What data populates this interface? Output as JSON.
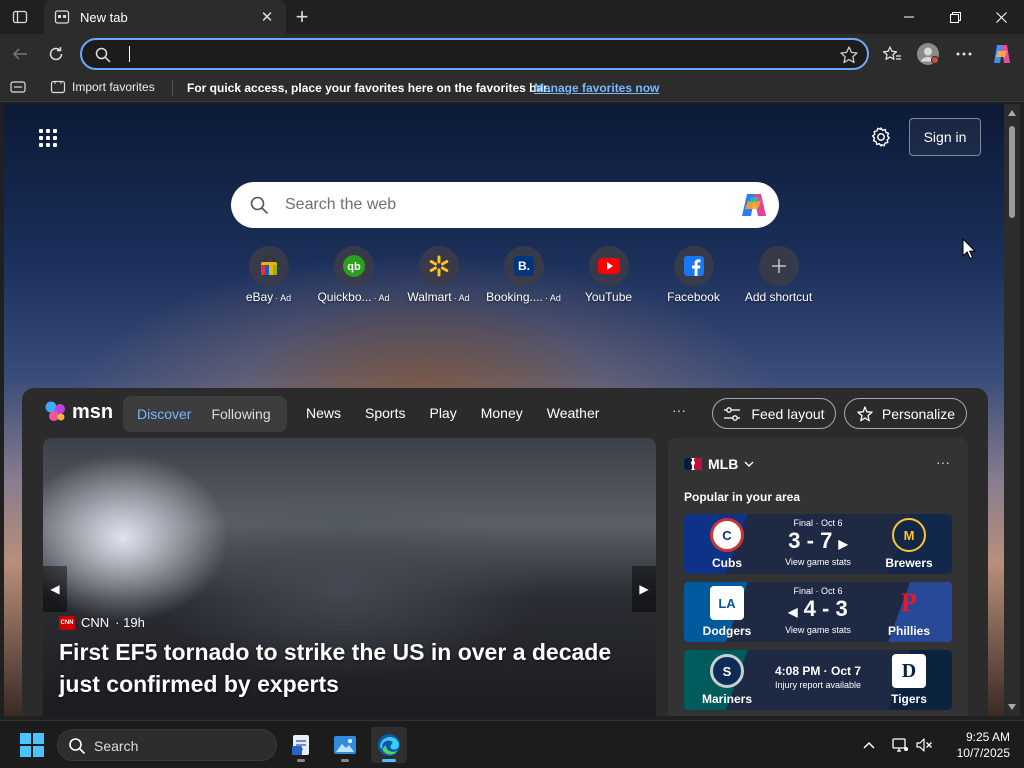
{
  "browser": {
    "tab": {
      "title": "New tab"
    },
    "omnibox": {
      "value": "",
      "placeholder": ""
    },
    "favorites_bar": {
      "import_label": "Import favorites",
      "hint": "For quick access, place your favorites here on the favorites bar.",
      "manage_link": "Manage favorites now"
    }
  },
  "newtab": {
    "signin_label": "Sign in",
    "search": {
      "placeholder": "Search the web"
    },
    "shortcuts": [
      {
        "label": "eBay",
        "ad": "· Ad",
        "icon": "ebay-icon"
      },
      {
        "label": "Quickbo...",
        "ad": "· Ad",
        "icon": "quickbooks-icon"
      },
      {
        "label": "Walmart",
        "ad": "· Ad",
        "icon": "walmart-icon"
      },
      {
        "label": "Booking....",
        "ad": "· Ad",
        "icon": "booking-icon"
      },
      {
        "label": "YouTube",
        "ad": "",
        "icon": "youtube-icon"
      },
      {
        "label": "Facebook",
        "ad": "",
        "icon": "facebook-icon"
      },
      {
        "label": "Add shortcut",
        "ad": "",
        "icon": "plus-icon"
      }
    ]
  },
  "feed": {
    "brand": "msn",
    "tabs": [
      "Discover",
      "Following"
    ],
    "nav": [
      "News",
      "Sports",
      "Play",
      "Money",
      "Weather"
    ],
    "more": "···",
    "feed_layout_label": "Feed layout",
    "personalize_label": "Personalize",
    "hero": {
      "source": "CNN",
      "age": "· 19h",
      "source_badge": "CNN",
      "headline": "First EF5 tornado to strike the US in over a decade just confirmed by experts"
    },
    "mlb": {
      "title": "MLB",
      "more": "···",
      "subtitle": "Popular in your area",
      "games": [
        {
          "home": "Cubs",
          "away": "Brewers",
          "status": "Final · Oct 6",
          "score": "3 - 7",
          "stats": "View game stats",
          "home_mark": "C",
          "away_mark": "M"
        },
        {
          "home": "Dodgers",
          "away": "Phillies",
          "status": "Final · Oct 6",
          "score": "4 - 3",
          "stats": "View game stats",
          "home_mark": "LA",
          "away_mark": "P"
        },
        {
          "home": "Mariners",
          "away": "Tigers",
          "time": "4:08 PM · Oct 7",
          "note": "Injury report available",
          "home_mark": "S",
          "away_mark": "D"
        }
      ]
    }
  },
  "taskbar": {
    "search_label": "Search",
    "clock_time": "9:25 AM",
    "clock_date": "10/7/2025"
  },
  "colors": {
    "accent": "#7ab8ff",
    "omnibox_focus": "#6aa9ff",
    "windows_blue": "#4cc2ff"
  }
}
